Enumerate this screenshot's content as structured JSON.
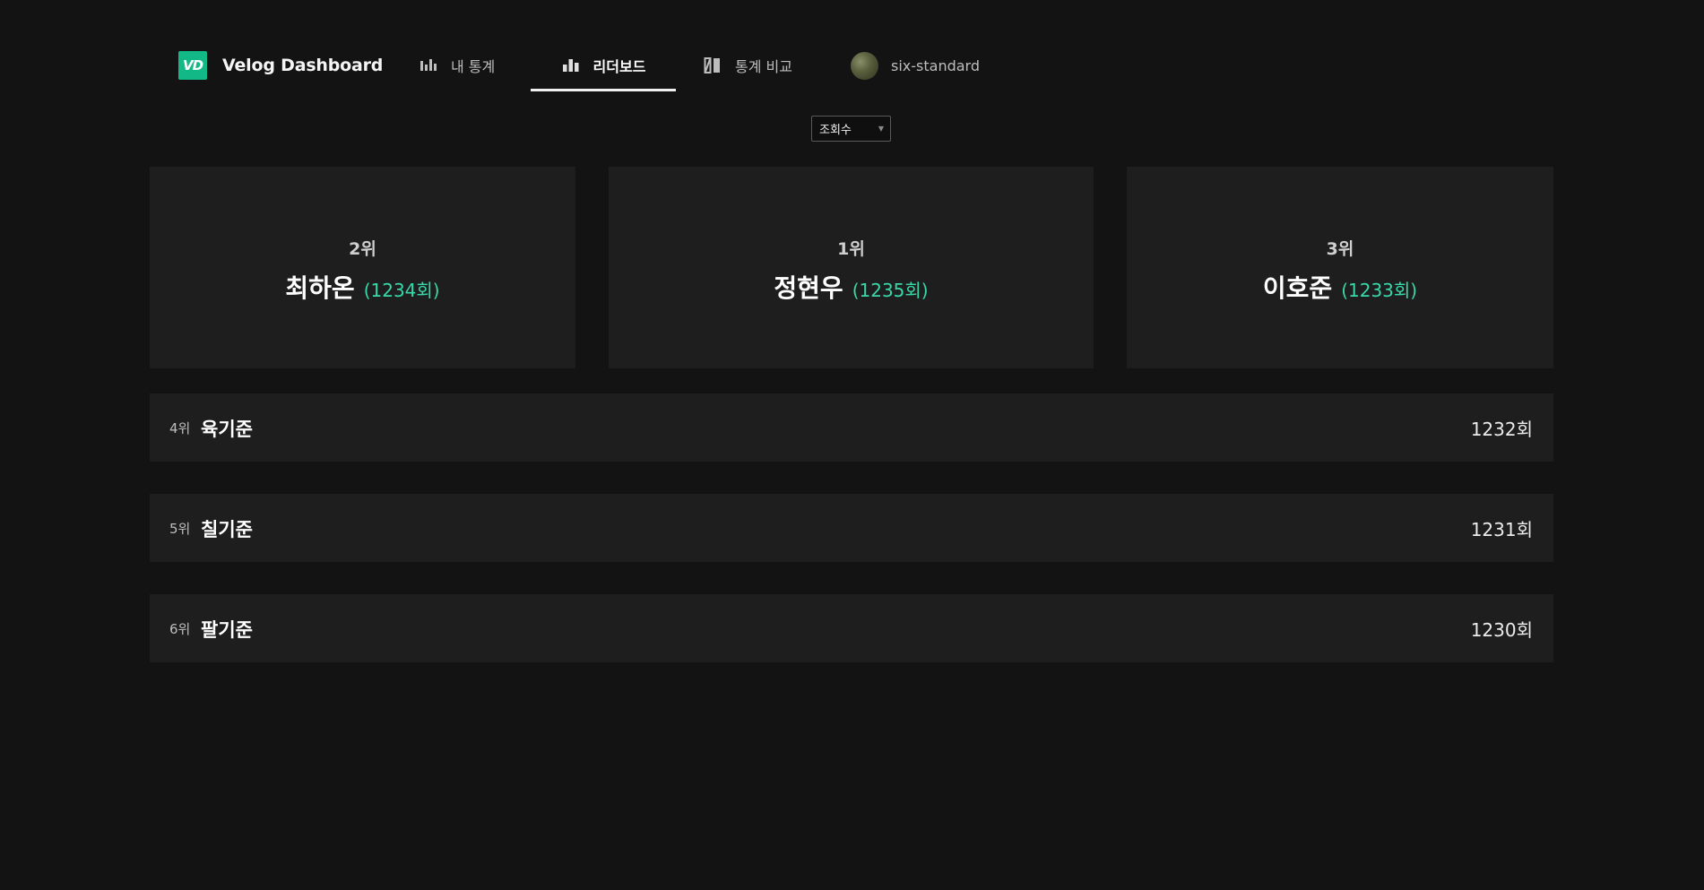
{
  "header": {
    "logo_text": "VD",
    "app_title": "Velog Dashboard",
    "nav": [
      {
        "label": "내 통계",
        "icon": "bar-chart-icon",
        "active": false
      },
      {
        "label": "리더보드",
        "icon": "leaderboard-icon",
        "active": true
      },
      {
        "label": "통계 비교",
        "icon": "compare-icon",
        "active": false
      }
    ],
    "user": {
      "name": "six-standard",
      "icon": "avatar"
    }
  },
  "sort": {
    "selected": "조회수"
  },
  "podium": [
    {
      "rank": "2위",
      "name": "최하온",
      "count": "(1234회)"
    },
    {
      "rank": "1위",
      "name": "정현우",
      "count": "(1235회)"
    },
    {
      "rank": "3위",
      "name": "이호준",
      "count": "(1233회)"
    }
  ],
  "list": [
    {
      "rank": "4위",
      "name": "육기준",
      "value": "1232회"
    },
    {
      "rank": "5위",
      "name": "칠기준",
      "value": "1231회"
    },
    {
      "rank": "6위",
      "name": "팔기준",
      "value": "1230회"
    }
  ],
  "colors": {
    "accent": "#38D9A9",
    "logo": "#12B886",
    "background": "#131313",
    "card": "#1E1E1E"
  }
}
